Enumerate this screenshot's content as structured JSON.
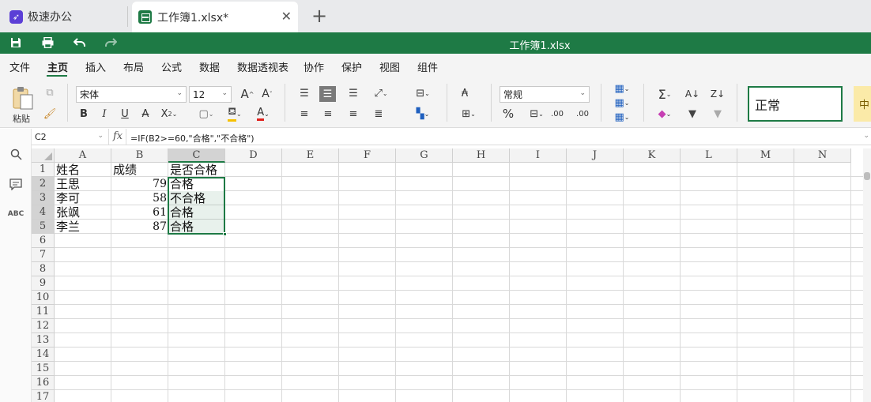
{
  "tabs": [
    {
      "label": "极速办公",
      "icon": "rocket-icon"
    },
    {
      "label": "工作簿1.xlsx*",
      "icon": "spreadsheet-icon"
    }
  ],
  "titlebar": {
    "title": "工作簿1.xlsx"
  },
  "menu": [
    "文件",
    "主页",
    "插入",
    "布局",
    "公式",
    "数据",
    "数据透视表",
    "协作",
    "保护",
    "视图",
    "组件"
  ],
  "ribbon": {
    "paste_label": "粘贴",
    "font_name": "宋体",
    "font_size": "12",
    "number_format": "常规",
    "cell_style": "正常",
    "cell_style_2": "中"
  },
  "formula_bar": {
    "name_box": "C2",
    "fx": "fx",
    "formula": "=IF(B2>=60,\"合格\",\"不合格\")"
  },
  "columns": [
    "A",
    "B",
    "C",
    "D",
    "E",
    "F",
    "G",
    "H",
    "I",
    "J",
    "K",
    "L",
    "M",
    "N"
  ],
  "rows": [
    "1",
    "2",
    "3",
    "4",
    "5",
    "6",
    "7",
    "8",
    "9",
    "10",
    "11",
    "12",
    "13",
    "14",
    "15",
    "16",
    "17"
  ],
  "cells": {
    "a1": "姓名",
    "b1": "成绩",
    "c1": "是否合格",
    "a2": "王思",
    "b2": "79",
    "c2": "合格",
    "a3": "李可",
    "b3": "58",
    "c3": "不合格",
    "a4": "张飒",
    "b4": "61",
    "c4": "合格",
    "a5": "李兰",
    "b5": "87",
    "c5": "合格"
  },
  "colors": {
    "accent": "#1e7a45",
    "selection_fill": "#e6f1ea"
  }
}
